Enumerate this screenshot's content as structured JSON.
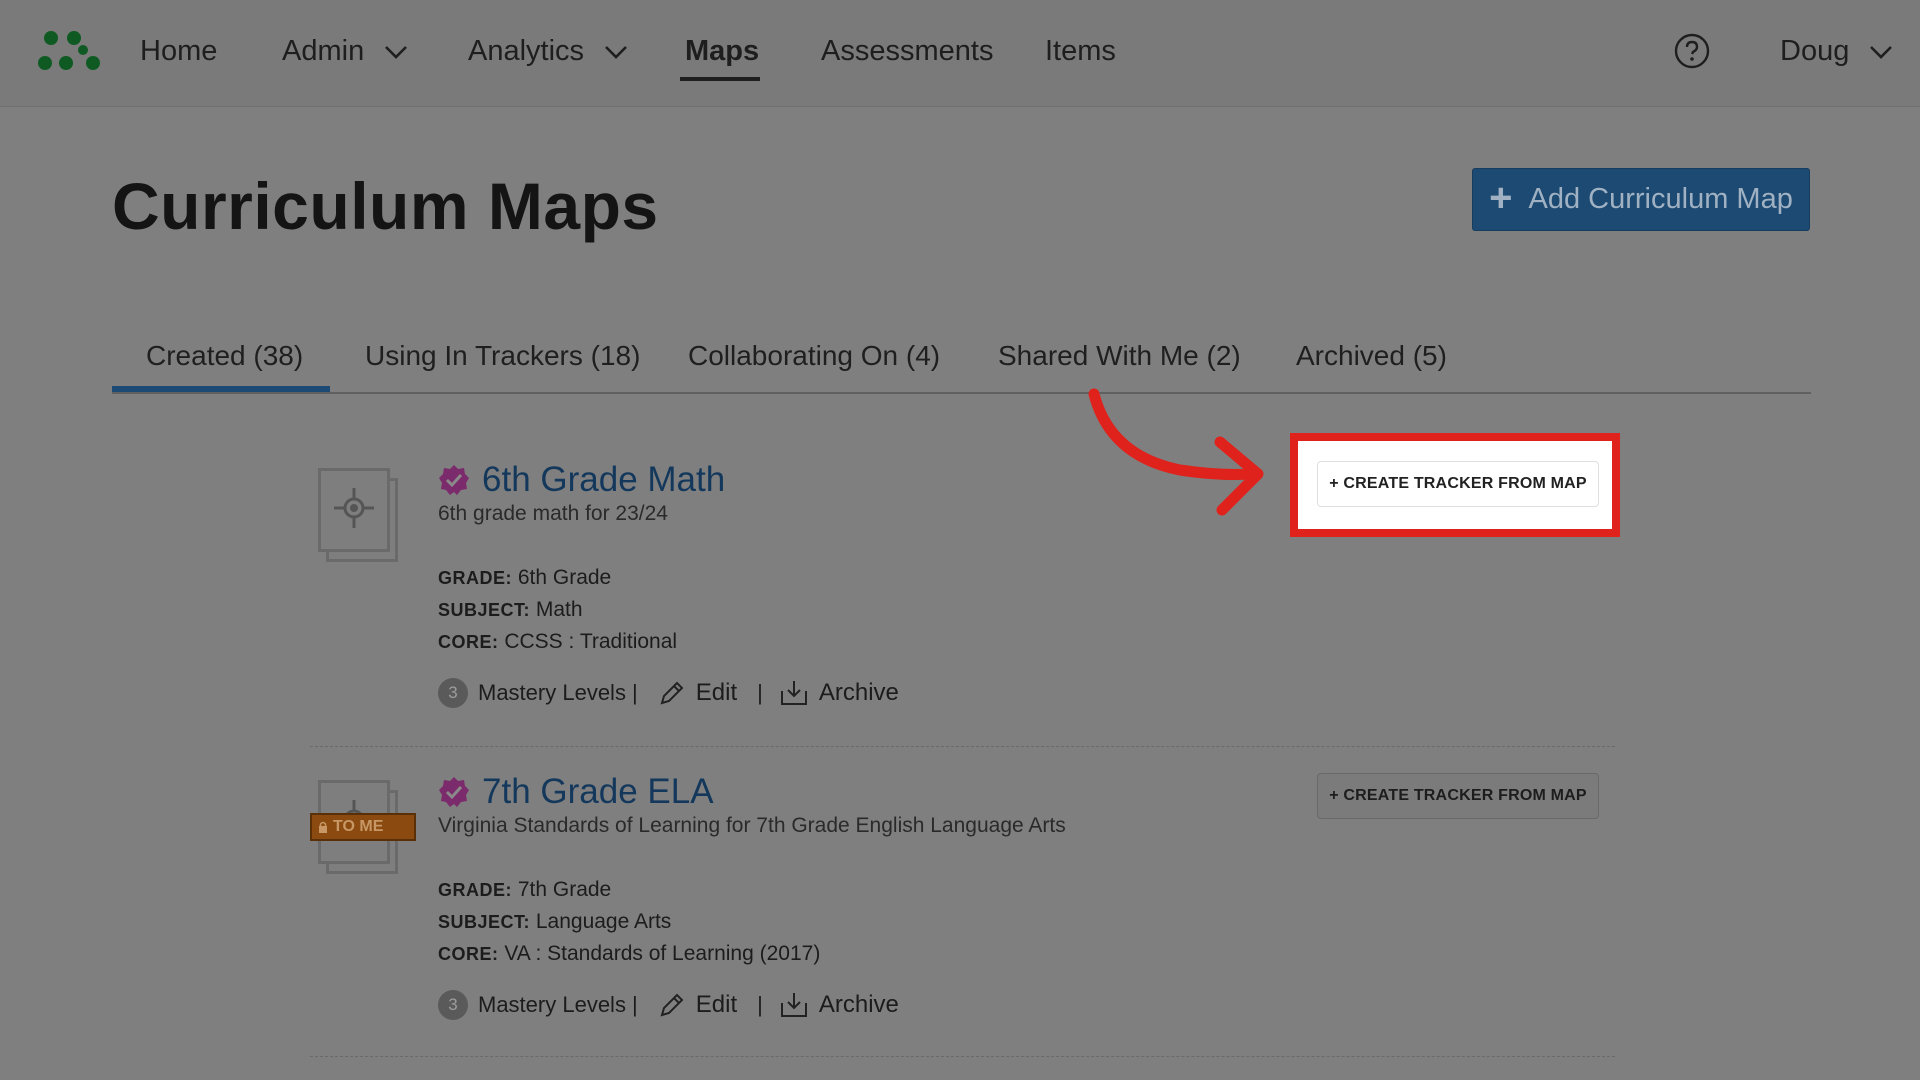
{
  "nav": {
    "home": "Home",
    "admin": "Admin",
    "analytics": "Analytics",
    "maps": "Maps",
    "assessments": "Assessments",
    "items": "Items",
    "user": "Doug"
  },
  "page": {
    "title": "Curriculum Maps",
    "add_button": "Add Curriculum Map"
  },
  "tabs": [
    {
      "label": "Created (38)",
      "active": true
    },
    {
      "label": "Using In Trackers (18)",
      "active": false
    },
    {
      "label": "Collaborating On (4)",
      "active": false
    },
    {
      "label": "Shared With Me (2)",
      "active": false
    },
    {
      "label": "Archived (5)",
      "active": false
    }
  ],
  "labels": {
    "grade": "GRADE:",
    "subject": "SUBJECT:",
    "core": "CORE:",
    "mastery_levels": "Mastery Levels |",
    "edit": "Edit",
    "archive": "Archive",
    "divider": "|",
    "create_tracker": "+ CREATE TRACKER FROM MAP"
  },
  "maps": [
    {
      "title": "6th Grade Math",
      "description": "6th grade math for 23/24",
      "grade": "6th Grade",
      "subject": "Math",
      "core": "CCSS : Traditional",
      "mastery_count": "3"
    },
    {
      "title": "7th Grade ELA",
      "description": "Virginia Standards of Learning for 7th Grade English Language Arts",
      "grade": "7th Grade",
      "subject": "Language Arts",
      "core": "VA : Standards of Learning (2017)",
      "mastery_count": "3",
      "ribbon": "TO ME"
    }
  ],
  "colors": {
    "accent": "#1d4a72",
    "highlight": "#e0221c",
    "verified_badge": "#7b2a6b",
    "title_link": "#13385c",
    "logo": "#0f5a22"
  }
}
